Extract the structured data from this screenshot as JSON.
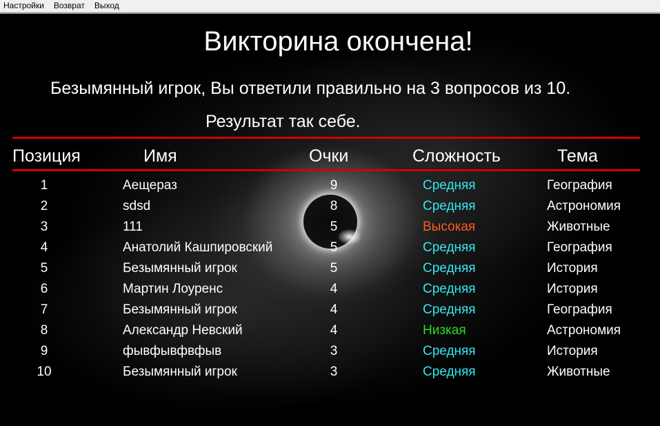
{
  "menu": {
    "settings": "Настройки",
    "back": "Возврат",
    "exit": "Выход"
  },
  "title": "Викторина окончена!",
  "message": "Безымянный игрок, Вы ответили правильно на 3 вопросов из 10.",
  "verdict": "Результат так себе.",
  "table": {
    "headers": {
      "position": "Позиция",
      "name": "Имя",
      "score": "Очки",
      "difficulty": "Сложность",
      "topic": "Тема"
    },
    "rows": [
      {
        "position": "1",
        "name": "Аещераз",
        "score": "9",
        "difficulty": "Средняя",
        "topic": "География"
      },
      {
        "position": "2",
        "name": "sdsd",
        "score": "8",
        "difficulty": "Средняя",
        "topic": "Астрономия"
      },
      {
        "position": "3",
        "name": "111",
        "score": "5",
        "difficulty": "Высокая",
        "topic": "Животные"
      },
      {
        "position": "4",
        "name": "Анатолий Кашпировский",
        "score": "5",
        "difficulty": "Средняя",
        "topic": "География"
      },
      {
        "position": "5",
        "name": "Безымянный игрок",
        "score": "5",
        "difficulty": "Средняя",
        "topic": "История"
      },
      {
        "position": "6",
        "name": "Мартин Лоуренс",
        "score": "4",
        "difficulty": "Средняя",
        "topic": "История"
      },
      {
        "position": "7",
        "name": "Безымянный игрок",
        "score": "4",
        "difficulty": "Средняя",
        "topic": "География"
      },
      {
        "position": "8",
        "name": "Александр Невский",
        "score": "4",
        "difficulty": "Низкая",
        "topic": "Астрономия"
      },
      {
        "position": "9",
        "name": "фывфывфвфыв",
        "score": "3",
        "difficulty": "Средняя",
        "topic": "История"
      },
      {
        "position": "10",
        "name": "Безымянный игрок",
        "score": "3",
        "difficulty": "Средняя",
        "topic": "Животные"
      }
    ]
  },
  "colors": {
    "rule": "#d40000",
    "medium": "#33e6f0",
    "high": "#ff5a1e",
    "low": "#22dd22",
    "text": "#ffffff"
  }
}
